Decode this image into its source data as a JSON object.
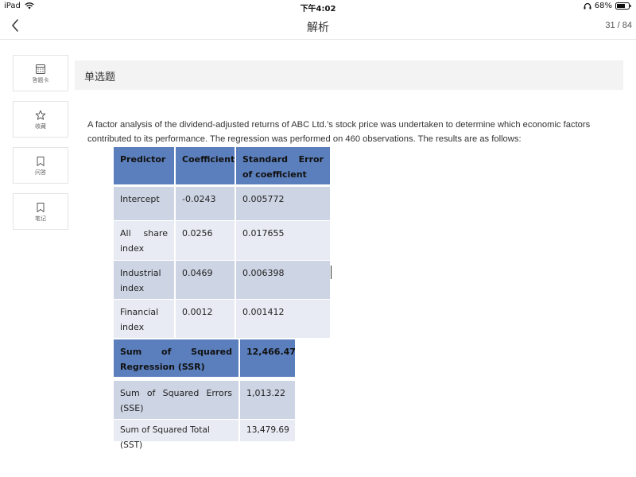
{
  "status_bar": {
    "device": "iPad",
    "time": "下午4:02",
    "battery": "68%"
  },
  "nav": {
    "title": "解析",
    "page_indicator": "31 / 84"
  },
  "tools": [
    {
      "label": "答题卡",
      "icon": "calculator-icon"
    },
    {
      "label": "收藏",
      "icon": "star-icon"
    },
    {
      "label": "问答",
      "icon": "bookmark-icon"
    },
    {
      "label": "笔记",
      "icon": "bookmark-icon"
    }
  ],
  "section": {
    "header": "单选题"
  },
  "question": {
    "text": "A factor analysis of the dividend-adjusted returns of ABC Ltd.’s stock price was undertaken to determine which economic factors contributed to its performance. The regression was performed on 460 observations. The results are as follows:"
  },
  "table": {
    "headers": [
      "Predictor",
      "Coefficient",
      "Standard Error of coefficient"
    ],
    "rows": [
      [
        "Intercept",
        "-0.0243",
        "0.005772"
      ],
      [
        "All share index",
        "0.0256",
        "0.017655"
      ],
      [
        "Industrial index",
        "0.0469",
        "0.006398"
      ],
      [
        "Financial index",
        "0.0012",
        "0.001412"
      ]
    ],
    "summary": [
      [
        "Sum of Squared Regression (SSR)",
        "12,466.47"
      ],
      [
        "Sum of Squared Errors (SSE)",
        "1,013.22"
      ],
      [
        "Sum of Squared Total (SST)",
        "13,479.69"
      ]
    ]
  },
  "colors": {
    "header_blue": "#5b7fbd",
    "row_dark": "#cdd4e3",
    "row_light": "#e8ebf3"
  }
}
